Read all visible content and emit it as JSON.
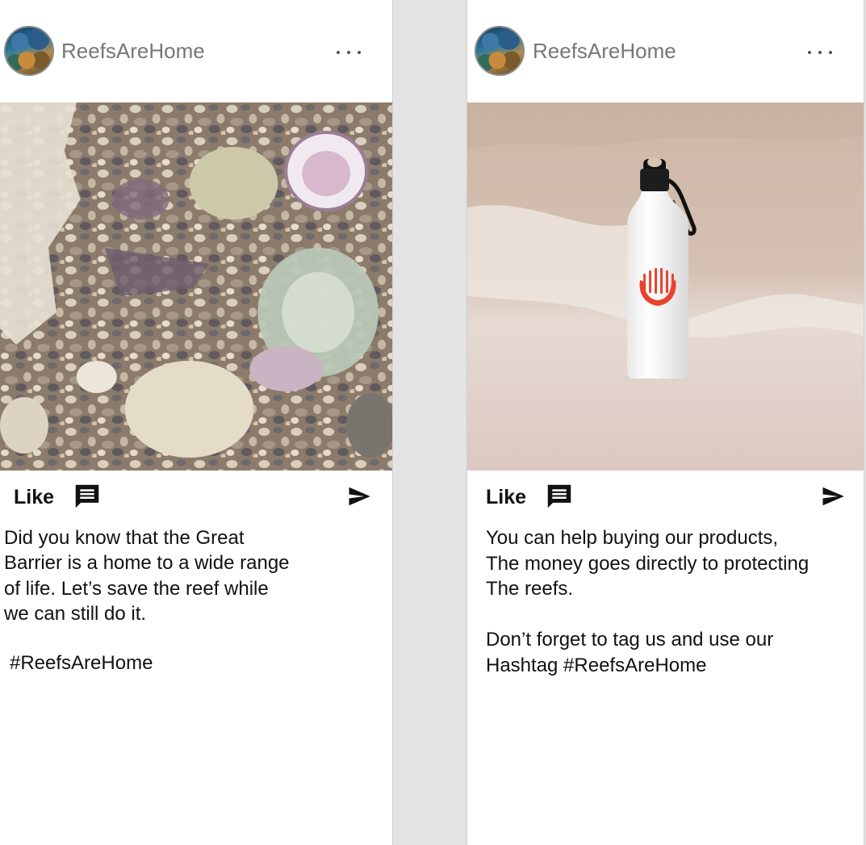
{
  "posts": [
    {
      "username": "ReefsAreHome",
      "more_label": "...",
      "image_alt": "Coral fragments and shells",
      "like_label": "Like",
      "caption": "Did you know that the Great\nBarrier is a home to a wide range\nof life. Let’s save the reef while\nwe can still do it.",
      "hashtag": "#ReefsAreHome"
    },
    {
      "username": "ReefsAreHome",
      "more_label": "...",
      "image_alt": "White water bottle on beach sand",
      "like_label": "Like",
      "caption": "You can help buying our products,\nThe money goes directly to protecting\nThe reefs.\n\nDon’t forget to tag us and use our\nHashtag #ReefsAreHome"
    }
  ],
  "colors": {
    "background": "#e3e3e3",
    "card": "#ffffff",
    "username": "#777777",
    "text": "#111111",
    "logo_red": "#e8432e"
  },
  "icons": [
    "more-icon",
    "comment-icon",
    "send-icon",
    "avatar"
  ]
}
